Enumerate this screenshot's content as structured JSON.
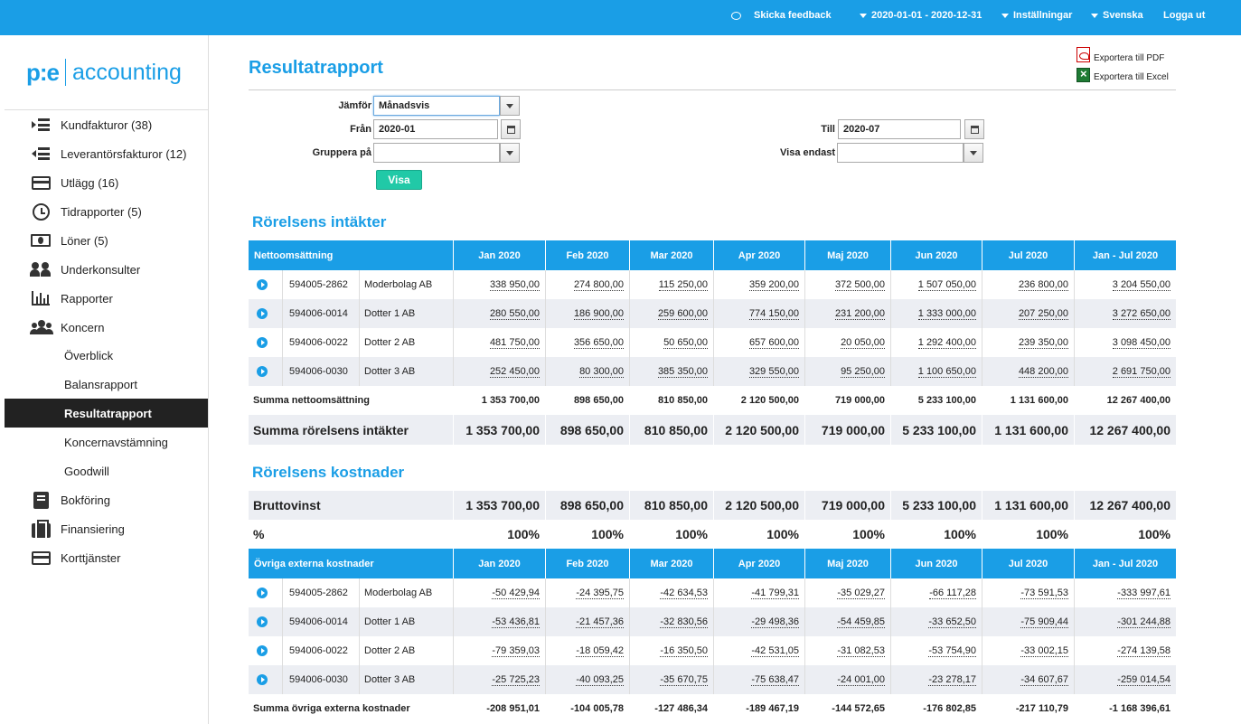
{
  "topbar": {
    "feedback": "Skicka feedback",
    "period": "2020-01-01 - 2020-12-31",
    "settings": "Inställningar",
    "language": "Svenska",
    "logout": "Logga ut"
  },
  "logo": {
    "left": "p:e",
    "right": "accounting"
  },
  "sidebar": {
    "items": [
      {
        "label": "Kundfakturor (38)",
        "icon": "invoice-in-icon"
      },
      {
        "label": "Leverantörsfakturor (12)",
        "icon": "invoice-out-icon"
      },
      {
        "label": "Utlägg (16)",
        "icon": "credit-card-icon"
      },
      {
        "label": "Tidrapporter (5)",
        "icon": "clock-icon"
      },
      {
        "label": "Löner (5)",
        "icon": "money-icon"
      },
      {
        "label": "Underkonsulter",
        "icon": "people-icon"
      },
      {
        "label": "Rapporter",
        "icon": "bar-chart-icon"
      },
      {
        "label": "Koncern",
        "icon": "group-icon"
      }
    ],
    "subitems": [
      {
        "label": "Överblick"
      },
      {
        "label": "Balansrapport"
      },
      {
        "label": "Resultatrapport"
      },
      {
        "label": "Koncernavstämning"
      },
      {
        "label": "Goodwill"
      }
    ],
    "items2": [
      {
        "label": "Bokföring",
        "icon": "book-icon"
      },
      {
        "label": "Finansiering",
        "icon": "briefcase-icon"
      },
      {
        "label": "Korttjänster",
        "icon": "card-icon"
      }
    ]
  },
  "page": {
    "title": "Resultatrapport",
    "export_pdf": "Exportera till PDF",
    "export_excel": "Exportera till Excel"
  },
  "filters": {
    "compare_label": "Jämför",
    "compare_value": "Månadsvis",
    "from_label": "Från",
    "from_value": "2020-01",
    "to_label": "Till",
    "to_value": "2020-07",
    "group_label": "Gruppera på",
    "group_value": "",
    "show_only_label": "Visa endast",
    "show_only_value": "",
    "submit": "Visa"
  },
  "columns": [
    "Jan 2020",
    "Feb 2020",
    "Mar 2020",
    "Apr 2020",
    "Maj 2020",
    "Jun 2020",
    "Jul 2020",
    "Jan - Jul 2020"
  ],
  "income": {
    "section_title": "Rörelsens intäkter",
    "header": "Nettoomsättning",
    "rows": [
      {
        "code": "594005-2862",
        "name": "Moderbolag AB",
        "values": [
          "338 950,00",
          "274 800,00",
          "115 250,00",
          "359 200,00",
          "372 500,00",
          "1 507 050,00",
          "236 800,00",
          "3 204 550,00"
        ]
      },
      {
        "code": "594006-0014",
        "name": "Dotter 1 AB",
        "values": [
          "280 550,00",
          "186 900,00",
          "259 600,00",
          "774 150,00",
          "231 200,00",
          "1 333 000,00",
          "207 250,00",
          "3 272 650,00"
        ]
      },
      {
        "code": "594006-0022",
        "name": "Dotter 2 AB",
        "values": [
          "481 750,00",
          "356 650,00",
          "50 650,00",
          "657 600,00",
          "20 050,00",
          "1 292 400,00",
          "239 350,00",
          "3 098 450,00"
        ]
      },
      {
        "code": "594006-0030",
        "name": "Dotter 3 AB",
        "values": [
          "252 450,00",
          "80 300,00",
          "385 350,00",
          "329 550,00",
          "95 250,00",
          "1 100 650,00",
          "448 200,00",
          "2 691 750,00"
        ]
      }
    ],
    "sum": {
      "label": "Summa nettoomsättning",
      "values": [
        "1 353 700,00",
        "898 650,00",
        "810 850,00",
        "2 120 500,00",
        "719 000,00",
        "5 233 100,00",
        "1 131 600,00",
        "12 267 400,00"
      ]
    },
    "total": {
      "label": "Summa rörelsens intäkter",
      "values": [
        "1 353 700,00",
        "898 650,00",
        "810 850,00",
        "2 120 500,00",
        "719 000,00",
        "5 233 100,00",
        "1 131 600,00",
        "12 267 400,00"
      ]
    }
  },
  "costs": {
    "section_title": "Rörelsens kostnader",
    "gross": {
      "label": "Bruttovinst",
      "values": [
        "1 353 700,00",
        "898 650,00",
        "810 850,00",
        "2 120 500,00",
        "719 000,00",
        "5 233 100,00",
        "1 131 600,00",
        "12 267 400,00"
      ]
    },
    "percent": {
      "label": "%",
      "values": [
        "100%",
        "100%",
        "100%",
        "100%",
        "100%",
        "100%",
        "100%",
        "100%"
      ]
    },
    "header": "Övriga externa kostnader",
    "rows": [
      {
        "code": "594005-2862",
        "name": "Moderbolag AB",
        "values": [
          "-50 429,94",
          "-24 395,75",
          "-42 634,53",
          "-41 799,31",
          "-35 029,27",
          "-66 117,28",
          "-73 591,53",
          "-333 997,61"
        ]
      },
      {
        "code": "594006-0014",
        "name": "Dotter 1 AB",
        "values": [
          "-53 436,81",
          "-21 457,36",
          "-32 830,56",
          "-29 498,36",
          "-54 459,85",
          "-33 652,50",
          "-75 909,44",
          "-301 244,88"
        ]
      },
      {
        "code": "594006-0022",
        "name": "Dotter 2 AB",
        "values": [
          "-79 359,03",
          "-18 059,42",
          "-16 350,50",
          "-42 531,05",
          "-31 082,53",
          "-53 754,90",
          "-33 002,15",
          "-274 139,58"
        ]
      },
      {
        "code": "594006-0030",
        "name": "Dotter 3 AB",
        "values": [
          "-25 725,23",
          "-40 093,25",
          "-35 670,75",
          "-75 638,47",
          "-24 001,00",
          "-23 278,17",
          "-34 607,67",
          "-259 014,54"
        ]
      }
    ],
    "sum": {
      "label": "Summa övriga externa kostnader",
      "values": [
        "-208 951,01",
        "-104 005,78",
        "-127 486,34",
        "-189 467,19",
        "-144 572,65",
        "-176 802,85",
        "-217 110,79",
        "-1 168 396,61"
      ]
    }
  }
}
